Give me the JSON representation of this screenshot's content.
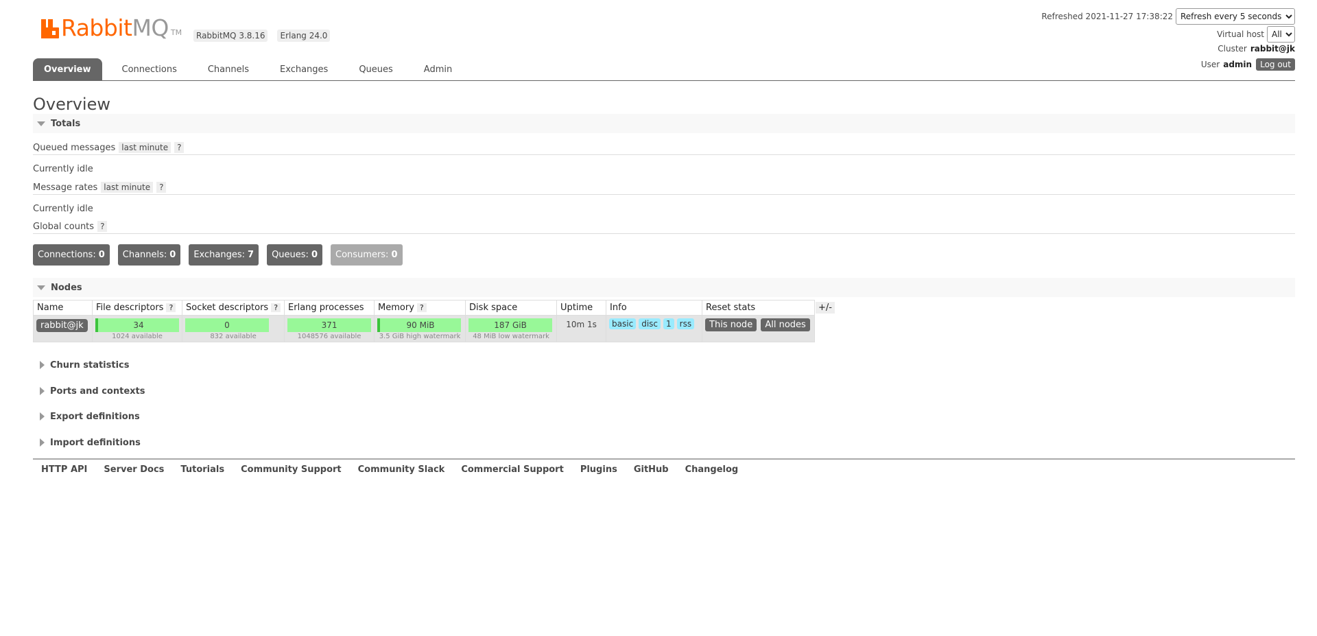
{
  "header": {
    "logo_rabbit": "Rabbit",
    "logo_mq": "MQ",
    "logo_tm": "TM",
    "rabbitmq_version": "RabbitMQ 3.8.16",
    "erlang_version": "Erlang 24.0",
    "refreshed_label": "Refreshed 2021-11-27 17:38:22",
    "refresh_select": "Refresh every 5 seconds",
    "vhost_label": "Virtual host",
    "vhost_select": "All",
    "cluster_label": "Cluster",
    "cluster_value": "rabbit@jk",
    "user_label": "User",
    "user_value": "admin",
    "logout_label": "Log out"
  },
  "tabs": [
    {
      "label": "Overview",
      "active": true
    },
    {
      "label": "Connections"
    },
    {
      "label": "Channels"
    },
    {
      "label": "Exchanges"
    },
    {
      "label": "Queues"
    },
    {
      "label": "Admin"
    }
  ],
  "page_title": "Overview",
  "totals": {
    "heading": "Totals",
    "queued_label": "Queued messages",
    "queued_range": "last minute",
    "help": "?",
    "queued_idle": "Currently idle",
    "rates_label": "Message rates",
    "rates_range": "last minute",
    "rates_idle": "Currently idle",
    "global_label": "Global counts"
  },
  "counts": [
    {
      "label": "Connections:",
      "value": "0"
    },
    {
      "label": "Channels:",
      "value": "0"
    },
    {
      "label": "Exchanges:",
      "value": "7"
    },
    {
      "label": "Queues:",
      "value": "0"
    },
    {
      "label": "Consumers:",
      "value": "0"
    }
  ],
  "nodes": {
    "heading": "Nodes",
    "columns": [
      "Name",
      "File descriptors",
      "Socket descriptors",
      "Erlang processes",
      "Memory",
      "Disk space",
      "Uptime",
      "Info",
      "Reset stats"
    ],
    "plusminus": "+/-",
    "row": {
      "name": "rabbit@jk",
      "file_desc": "34",
      "file_desc_note": "1024 available",
      "socket_desc": "0",
      "socket_desc_note": "832 available",
      "erlang_proc": "371",
      "erlang_proc_note": "1048576 available",
      "memory": "90 MiB",
      "memory_note": "3.5 GiB high watermark",
      "disk": "187 GiB",
      "disk_note": "48 MiB low watermark",
      "uptime": "10m 1s",
      "info": [
        "basic",
        "disc",
        "1",
        "rss"
      ],
      "reset_this": "This node",
      "reset_all": "All nodes"
    }
  },
  "collapsed_sections": [
    "Churn statistics",
    "Ports and contexts",
    "Export definitions",
    "Import definitions"
  ],
  "footer": [
    "HTTP API",
    "Server Docs",
    "Tutorials",
    "Community Support",
    "Community Slack",
    "Commercial Support",
    "Plugins",
    "GitHub",
    "Changelog"
  ],
  "colors": {
    "brand_orange": "#ff6600",
    "tab_active": "#666666",
    "bar_green": "#98f898",
    "info_chip": "#99ebff"
  }
}
